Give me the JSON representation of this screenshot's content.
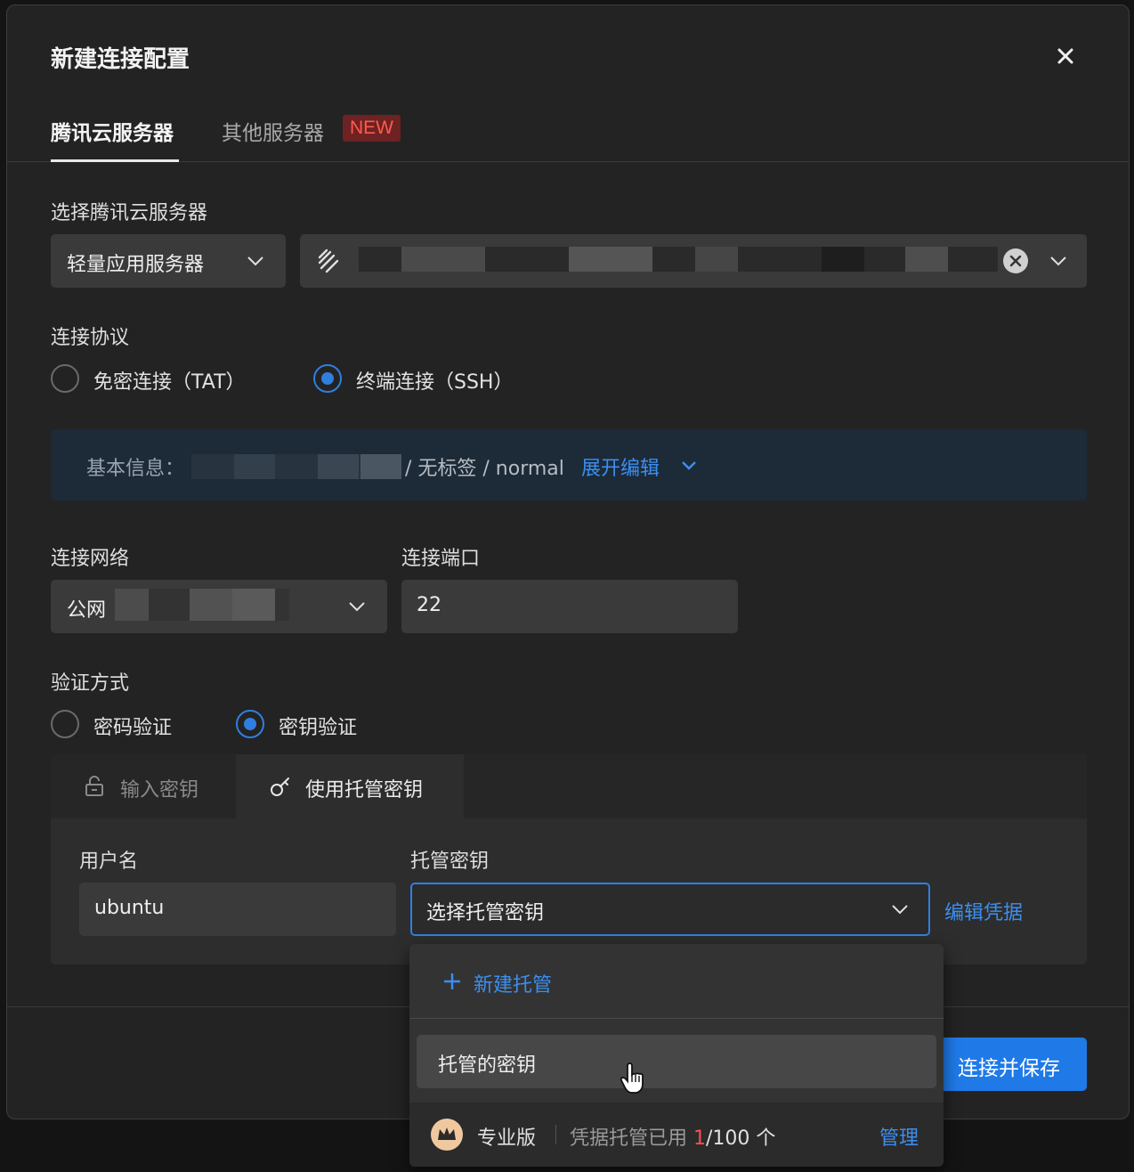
{
  "dialog": {
    "title": "新建连接配置",
    "close_icon": "close-icon"
  },
  "tabs": {
    "active": "腾讯云服务器",
    "other": "其他服务器",
    "new_badge": "NEW"
  },
  "server": {
    "label": "选择腾讯云服务器",
    "type_value": "轻量应用服务器",
    "instance_icon": "lighthouse-icon"
  },
  "protocol": {
    "label": "连接协议",
    "options": [
      "免密连接（TAT）",
      "终端连接（SSH）"
    ],
    "selected": "终端连接（SSH）"
  },
  "basic_info": {
    "label": "基本信息：",
    "tail": "/ 无标签 / normal",
    "expand_link": "展开编辑"
  },
  "network": {
    "label": "连接网络",
    "value": "公网"
  },
  "port": {
    "label": "连接端口",
    "value": "22"
  },
  "auth": {
    "label": "验证方式",
    "options": [
      "密码验证",
      "密钥验证"
    ],
    "selected": "密钥验证",
    "subtabs": [
      "输入密钥",
      "使用托管密钥"
    ],
    "active_subtab": "使用托管密钥"
  },
  "username": {
    "label": "用户名",
    "value": "ubuntu"
  },
  "managed_key": {
    "label": "托管密钥",
    "placeholder": "选择托管密钥",
    "edit_link": "编辑凭据"
  },
  "dropdown": {
    "new_label": "新建托管",
    "items": [
      "托管的密钥"
    ],
    "plan": "专业版",
    "usage_prefix": "凭据托管已用",
    "usage_used": "1",
    "usage_rest": "/100 个",
    "manage_link": "管理"
  },
  "footer": {
    "primary_button": "连接并保存"
  },
  "colors": {
    "accent": "#2f7fe0",
    "badge_red": "#ff5a50",
    "info_bg": "#1d2a38"
  }
}
